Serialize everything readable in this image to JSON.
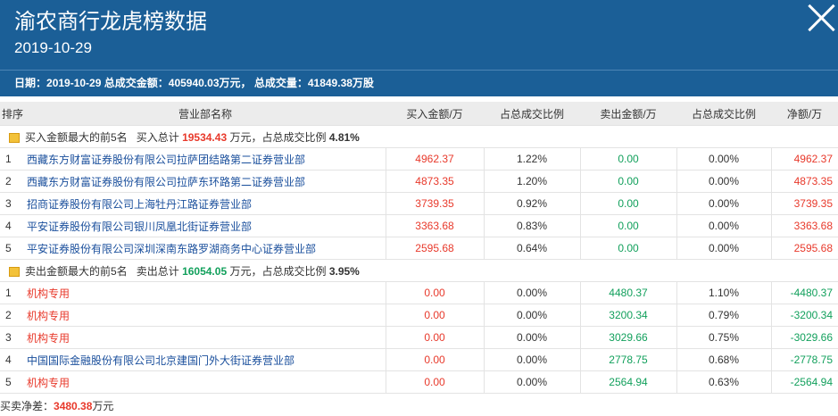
{
  "header": {
    "title": "渝农商行龙虎榜数据",
    "date": "2019-10-29",
    "summary": {
      "date_label": "日期：",
      "date": "2019-10-29",
      "amount_label": "总成交金额：",
      "amount": "405940.03万元",
      "volume_label": "总成交量：",
      "volume": "41849.38万股"
    }
  },
  "table": {
    "columns": [
      "排序",
      "营业部名称",
      "买入金额/万",
      "占总成交比例",
      "卖出金额/万",
      "占总成交比例",
      "净额/万"
    ],
    "buy_group": {
      "label": "买入金额最大的前5名",
      "total_label": "买入总计",
      "total": "19534.43",
      "unit_text": "万元，占总成交比例",
      "ratio": "4.81%"
    },
    "buy_rows": [
      {
        "rank": "1",
        "dept": "西藏东方财富证券股份有限公司拉萨团结路第二证券营业部",
        "buy": "4962.37",
        "buy_ratio": "1.22%",
        "sell": "0.00",
        "sell_ratio": "0.00%",
        "net": "4962.37"
      },
      {
        "rank": "2",
        "dept": "西藏东方财富证券股份有限公司拉萨东环路第二证券营业部",
        "buy": "4873.35",
        "buy_ratio": "1.20%",
        "sell": "0.00",
        "sell_ratio": "0.00%",
        "net": "4873.35"
      },
      {
        "rank": "3",
        "dept": "招商证券股份有限公司上海牡丹江路证券营业部",
        "buy": "3739.35",
        "buy_ratio": "0.92%",
        "sell": "0.00",
        "sell_ratio": "0.00%",
        "net": "3739.35"
      },
      {
        "rank": "4",
        "dept": "平安证券股份有限公司银川凤凰北街证券营业部",
        "buy": "3363.68",
        "buy_ratio": "0.83%",
        "sell": "0.00",
        "sell_ratio": "0.00%",
        "net": "3363.68"
      },
      {
        "rank": "5",
        "dept": "平安证券股份有限公司深圳深南东路罗湖商务中心证券营业部",
        "buy": "2595.68",
        "buy_ratio": "0.64%",
        "sell": "0.00",
        "sell_ratio": "0.00%",
        "net": "2595.68"
      }
    ],
    "sell_group": {
      "label": "卖出金额最大的前5名",
      "total_label": "卖出总计",
      "total": "16054.05",
      "unit_text": "万元，占总成交比例",
      "ratio": "3.95%"
    },
    "sell_rows": [
      {
        "rank": "1",
        "dept": "机构专用",
        "buy": "0.00",
        "buy_ratio": "0.00%",
        "sell": "4480.37",
        "sell_ratio": "1.10%",
        "net": "-4480.37"
      },
      {
        "rank": "2",
        "dept": "机构专用",
        "buy": "0.00",
        "buy_ratio": "0.00%",
        "sell": "3200.34",
        "sell_ratio": "0.79%",
        "net": "-3200.34"
      },
      {
        "rank": "3",
        "dept": "机构专用",
        "buy": "0.00",
        "buy_ratio": "0.00%",
        "sell": "3029.66",
        "sell_ratio": "0.75%",
        "net": "-3029.66"
      },
      {
        "rank": "4",
        "dept": "中国国际金融股份有限公司北京建国门外大街证券营业部",
        "buy": "0.00",
        "buy_ratio": "0.00%",
        "sell": "2778.75",
        "sell_ratio": "0.68%",
        "net": "-2778.75"
      },
      {
        "rank": "5",
        "dept": "机构专用",
        "buy": "0.00",
        "buy_ratio": "0.00%",
        "sell": "2564.94",
        "sell_ratio": "0.63%",
        "net": "-2564.94"
      }
    ]
  },
  "footer": {
    "label": "买卖净差：",
    "value": "3480.38",
    "unit": "万元"
  },
  "colors": {
    "header_bg": "#1b5f97",
    "up": "#e8392b",
    "down": "#12a05c",
    "link": "#1a4f9c"
  },
  "icons": [
    "close-icon",
    "group-folder-icon"
  ]
}
